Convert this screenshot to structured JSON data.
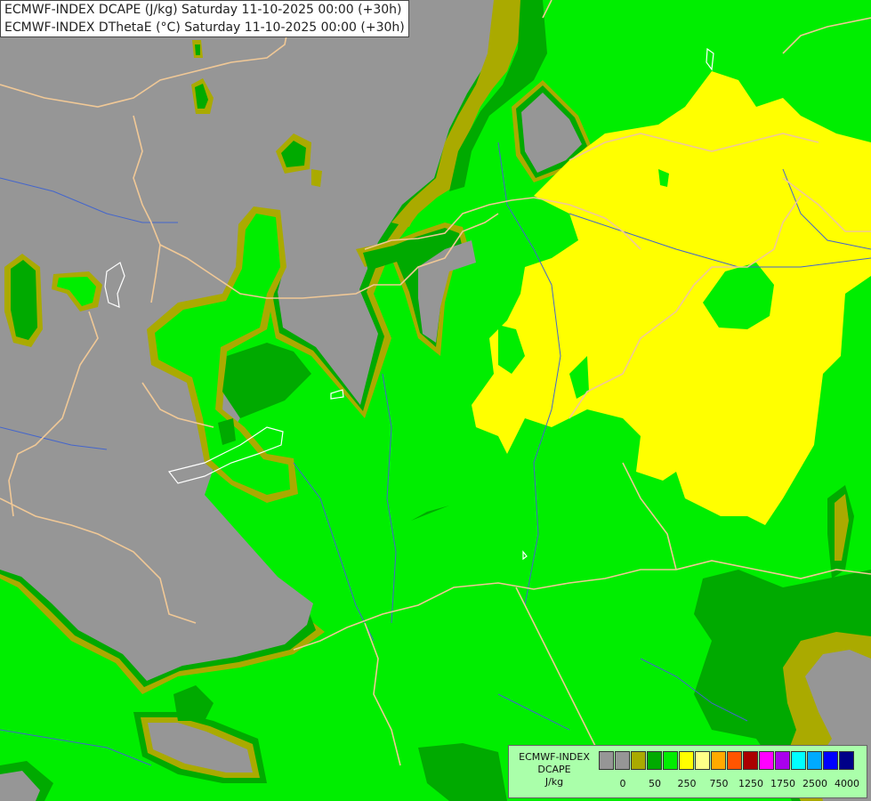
{
  "titles": {
    "line1": "ECMWF-INDEX DCAPE (J/kg) Saturday 11-10-2025 00:00 (+30h)",
    "line2": "ECMWF-INDEX DThetaE (°C) Saturday 11-10-2025 00:00 (+30h)"
  },
  "legend": {
    "model": "ECMWF-INDEX",
    "parameter": "DCAPE",
    "unit": "J/kg",
    "colors": [
      "#969696",
      "#969696",
      "#aaaa00",
      "#00aa00",
      "#00ee00",
      "#ffff00",
      "#ffff88",
      "#ffaa00",
      "#ff5500",
      "#aa0000",
      "#ff00ff",
      "#aa00ee",
      "#00ffff",
      "#00aaff",
      "#0000ff",
      "#000088"
    ],
    "tick_labels": [
      "0",
      "50",
      "250",
      "750",
      "1250",
      "1750",
      "2500",
      "4000"
    ]
  },
  "colors": {
    "gray": "#969696",
    "olive": "#aaaa00",
    "dark_green": "#00aa00",
    "green": "#00ee00",
    "yellow": "#ffff00",
    "border": "#f0c896",
    "river": "#4466cc"
  }
}
